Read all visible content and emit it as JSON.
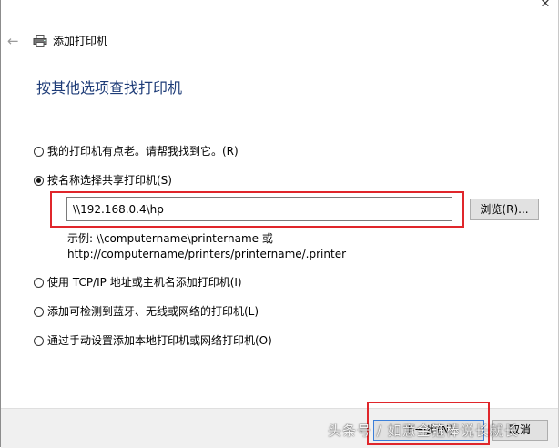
{
  "window": {
    "title": "添加打印机",
    "close_glyph": "✕",
    "back_glyph": "←",
    "icons": {
      "back": "back-arrow-icon",
      "printer": "printer-icon",
      "close": "close-icon"
    }
  },
  "page": {
    "heading": "按其他选项查找打印机"
  },
  "options": [
    {
      "label": "我的打印机有点老。请帮我找到它。(R)",
      "checked": false
    },
    {
      "label": "按名称选择共享打印机(S)",
      "checked": true
    },
    {
      "label": "使用 TCP/IP 地址或主机名添加打印机(I)",
      "checked": false
    },
    {
      "label": "添加可检测到蓝牙、无线或网络的打印机(L)",
      "checked": false
    },
    {
      "label": "通过手动设置添加本地打印机或网络打印机(O)",
      "checked": false
    }
  ],
  "share_input": {
    "value": "\\\\192.168.0.4\\hp"
  },
  "browse_button": "浏览(R)...",
  "example": {
    "line1": "示例: \\\\computername\\printername 或",
    "line2": "http://computername/printers/printername/.printer"
  },
  "footer": {
    "next_label": "下一步(N)",
    "cancel_label": "取消"
  },
  "watermark": "头条号 / 如意金箍棒说长就长",
  "colors": {
    "heading": "#1e3c78",
    "highlight": "#e0262b",
    "footer_bg": "#f0f0f0"
  }
}
